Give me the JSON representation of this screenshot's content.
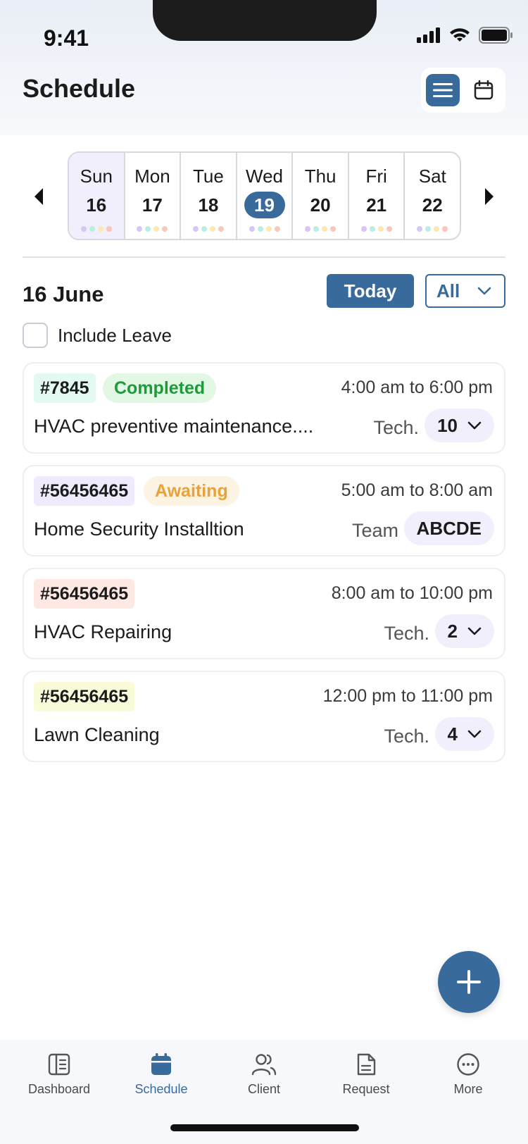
{
  "status_bar": {
    "time": "9:41"
  },
  "header": {
    "title": "Schedule"
  },
  "week": {
    "days": [
      {
        "name": "Sun",
        "num": "16",
        "selected": true,
        "today": false
      },
      {
        "name": "Mon",
        "num": "17",
        "selected": false,
        "today": false
      },
      {
        "name": "Tue",
        "num": "18",
        "selected": false,
        "today": false
      },
      {
        "name": "Wed",
        "num": "19",
        "selected": false,
        "today": true
      },
      {
        "name": "Thu",
        "num": "20",
        "selected": false,
        "today": false
      },
      {
        "name": "Fri",
        "num": "21",
        "selected": false,
        "today": false
      },
      {
        "name": "Sat",
        "num": "22",
        "selected": false,
        "today": false
      }
    ],
    "dot_colors": [
      "#d6c7f5",
      "#b8f0e0",
      "#fde7b3",
      "#f9c7bd"
    ]
  },
  "toolbar": {
    "date_heading": "16 June",
    "today_label": "Today",
    "filter_value": "All",
    "include_leave_label": "Include Leave"
  },
  "jobs": [
    {
      "id": "#7845",
      "id_bg": "#e3faf3",
      "status": "Completed",
      "status_color": "#1f9a3a",
      "status_bg": "#e2f8e5",
      "time": "4:00 am to 6:00 pm",
      "title": "HVAC preventive maintenance....",
      "assign_label": "Tech.",
      "assign_value": "10",
      "dropdown": true
    },
    {
      "id": "#56456465",
      "id_bg": "#efeafc",
      "status": "Awaiting",
      "status_color": "#e9a23b",
      "status_bg": "#fdf3e3",
      "time": "5:00 am to 8:00 am",
      "title": "Home Security Installtion",
      "assign_label": "Team",
      "assign_value": "ABCDE",
      "dropdown": false
    },
    {
      "id": "#56456465",
      "id_bg": "#fde8e4",
      "status": "",
      "time": "8:00 am to 10:00 pm",
      "title": "HVAC Repairing",
      "assign_label": "Tech.",
      "assign_value": "2",
      "dropdown": true
    },
    {
      "id": "#56456465",
      "id_bg": "#f9fbd9",
      "status": "",
      "time": "12:00 pm to 11:00 pm",
      "title": "Lawn Cleaning",
      "assign_label": "Tech.",
      "assign_value": "4",
      "dropdown": true
    }
  ],
  "tabs": [
    {
      "label": "Dashboard",
      "icon": "dashboard-icon",
      "active": false
    },
    {
      "label": "Schedule",
      "icon": "calendar-icon",
      "active": true
    },
    {
      "label": "Client",
      "icon": "users-icon",
      "active": false
    },
    {
      "label": "Request",
      "icon": "document-icon",
      "active": false
    },
    {
      "label": "More",
      "icon": "more-icon",
      "active": false
    }
  ],
  "colors": {
    "accent": "#386a9c"
  }
}
